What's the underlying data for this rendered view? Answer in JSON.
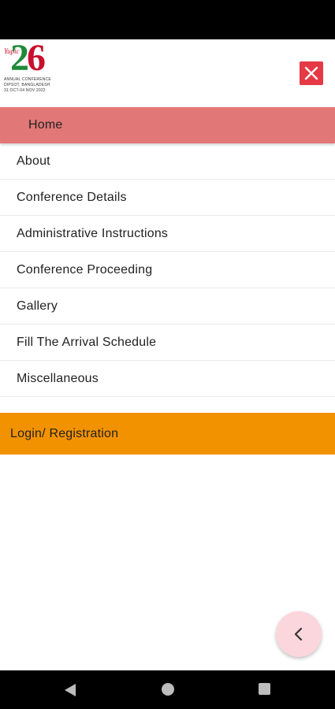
{
  "header": {
    "logo": {
      "number": "2",
      "number_accent": "6",
      "script": "Yupic",
      "line1": "ANNUAL CONFERENCE",
      "line2": "DIPSOT, BANGLADESH",
      "line3": "31 OCT-04 NOV 2022"
    },
    "close_icon": "close-icon"
  },
  "menu": {
    "items": [
      {
        "label": "Home",
        "active": true
      },
      {
        "label": "About"
      },
      {
        "label": "Conference Details"
      },
      {
        "label": "Administrative Instructions"
      },
      {
        "label": "Conference Proceeding"
      },
      {
        "label": "Gallery"
      },
      {
        "label": "Fill The Arrival Schedule"
      },
      {
        "label": "Miscellaneous"
      }
    ],
    "login_label": "Login/ Registration"
  },
  "fab": {
    "icon": "chevron-left-icon"
  },
  "nav": {
    "back_icon": "back-icon",
    "home_icon": "home-icon",
    "recent_icon": "recent-apps-icon"
  },
  "colors": {
    "active_item": "#e27777",
    "login_button": "#f39200",
    "close_button": "#e53945",
    "fab": "#fbd6dc"
  }
}
